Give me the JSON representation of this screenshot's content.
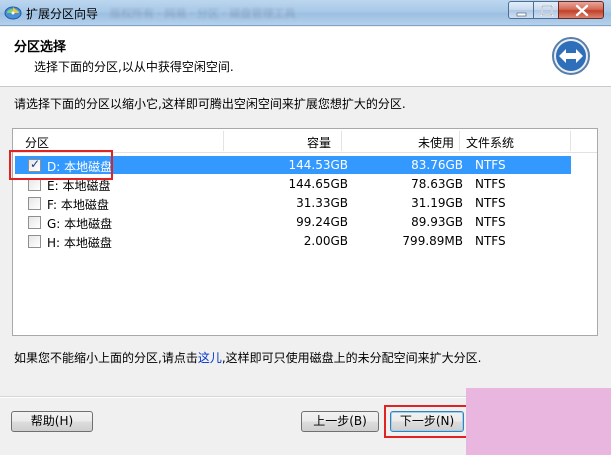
{
  "window": {
    "title": "扩展分区向导",
    "blurred_title": "版权所有 · 网易 · 分区 · 磁盘管理工具",
    "close_glyph": "✕",
    "min_glyph": "—",
    "max_glyph": "☐"
  },
  "header": {
    "title": "分区选择",
    "subtitle": "选择下面的分区,以从中获得空闲空间."
  },
  "instruction": "请选择下面的分区以缩小它,这样即可腾出空闲空间来扩展您想扩大的分区.",
  "table": {
    "columns": [
      "分区",
      "容量",
      "未使用",
      "文件系统"
    ],
    "rows": [
      {
        "name": "D: 本地磁盘",
        "capacity": "144.53GB",
        "unused": "83.76GB",
        "fs": "NTFS",
        "checked": true,
        "selected": true,
        "check_glyph": "✓"
      },
      {
        "name": "E: 本地磁盘",
        "capacity": "144.65GB",
        "unused": "78.63GB",
        "fs": "NTFS",
        "checked": false,
        "selected": false,
        "check_glyph": ""
      },
      {
        "name": "F: 本地磁盘",
        "capacity": "31.33GB",
        "unused": "31.19GB",
        "fs": "NTFS",
        "checked": false,
        "selected": false,
        "check_glyph": ""
      },
      {
        "name": "G: 本地磁盘",
        "capacity": "99.24GB",
        "unused": "89.93GB",
        "fs": "NTFS",
        "checked": false,
        "selected": false,
        "check_glyph": ""
      },
      {
        "name": "H: 本地磁盘",
        "capacity": "2.00GB",
        "unused": "799.89MB",
        "fs": "NTFS",
        "checked": false,
        "selected": false,
        "check_glyph": ""
      }
    ]
  },
  "note": {
    "before": "如果您不能缩小上面的分区,请点击",
    "link": "这儿",
    "after": ",这样即可只使用磁盘上的未分配空间来扩大分区."
  },
  "buttons": {
    "help": "帮助(H)",
    "back": "上一步(B)",
    "next": "下一步(N)"
  },
  "colors": {
    "selection": "#3399ff",
    "highlight": "#e02222",
    "link": "#0033cc"
  }
}
